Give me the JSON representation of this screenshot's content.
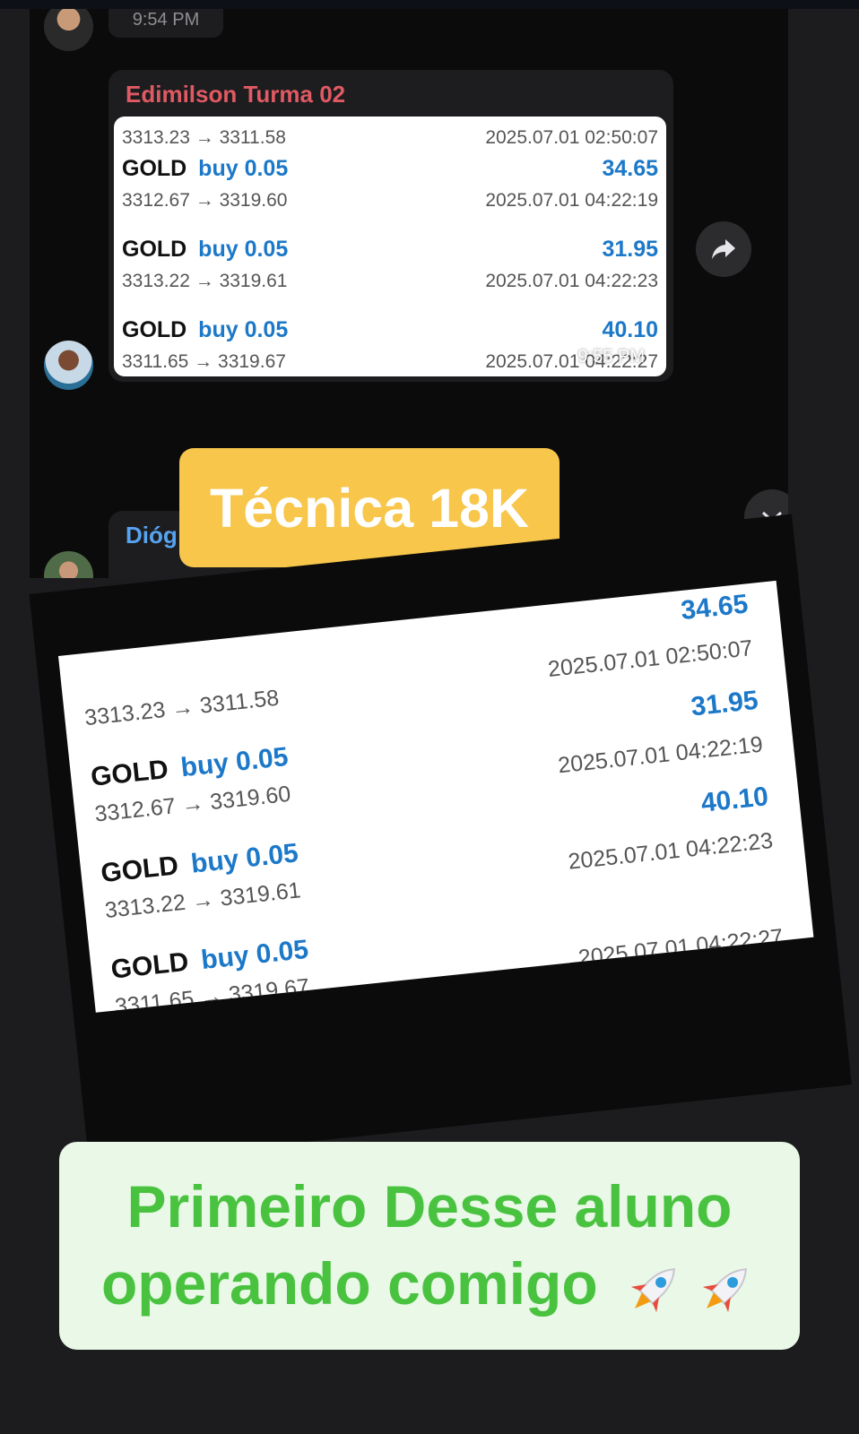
{
  "chat": {
    "earlier_time": "9:54 PM",
    "sender": "Edimilson Turma 02",
    "bubble_time": "9:55 PM",
    "partial_sender": "Dióg",
    "trades": [
      {
        "label": "GOLD",
        "side": "buy 0.05",
        "profit": "",
        "prices": "3313.23 → 3311.58",
        "date": "2025.07.01 02:50:07"
      },
      {
        "label": "GOLD",
        "side": "buy 0.05",
        "profit": "34.65",
        "prices": "3312.67 → 3319.60",
        "date": "2025.07.01 04:22:19"
      },
      {
        "label": "GOLD",
        "side": "buy 0.05",
        "profit": "31.95",
        "prices": "3313.22 → 3319.61",
        "date": "2025.07.01 04:22:23"
      },
      {
        "label": "GOLD",
        "side": "buy 0.05",
        "profit": "40.10",
        "prices": "3311.65 → 3319.67",
        "date": "2025.07.01 04:22:27"
      }
    ]
  },
  "banner": {
    "title": "Técnica 18K"
  },
  "zoom": {
    "trades": [
      {
        "label": "",
        "side": "",
        "profit": "34.65",
        "prices": "3313.23 → 3311.58",
        "date": "2025.07.01 02:50:07"
      },
      {
        "label": "GOLD",
        "side": "buy 0.05",
        "profit": "31.95",
        "prices": "3312.67 → 3319.60",
        "date": "2025.07.01 04:22:19"
      },
      {
        "label": "GOLD",
        "side": "buy 0.05",
        "profit": "40.10",
        "prices": "3313.22 → 3319.61",
        "date": "2025.07.01 04:22:23"
      },
      {
        "label": "GOLD",
        "side": "buy 0.05",
        "profit": "",
        "prices": "3311.65 → 3319.67",
        "date": "2025.07.01 04:22:27"
      }
    ]
  },
  "caption": {
    "line1": "Primeiro Desse aluno",
    "line2": "operando comigo"
  },
  "icons": {
    "share": "share-arrow-icon",
    "chevron": "chevron-down-icon",
    "mic": "microphone-icon",
    "rocket": "rocket-icon"
  },
  "colors": {
    "sender": "#e05a63",
    "blue": "#1c78c8",
    "banner": "#f7c64a",
    "caption_text": "#49c33f",
    "caption_bg": "#e9f8e7"
  }
}
